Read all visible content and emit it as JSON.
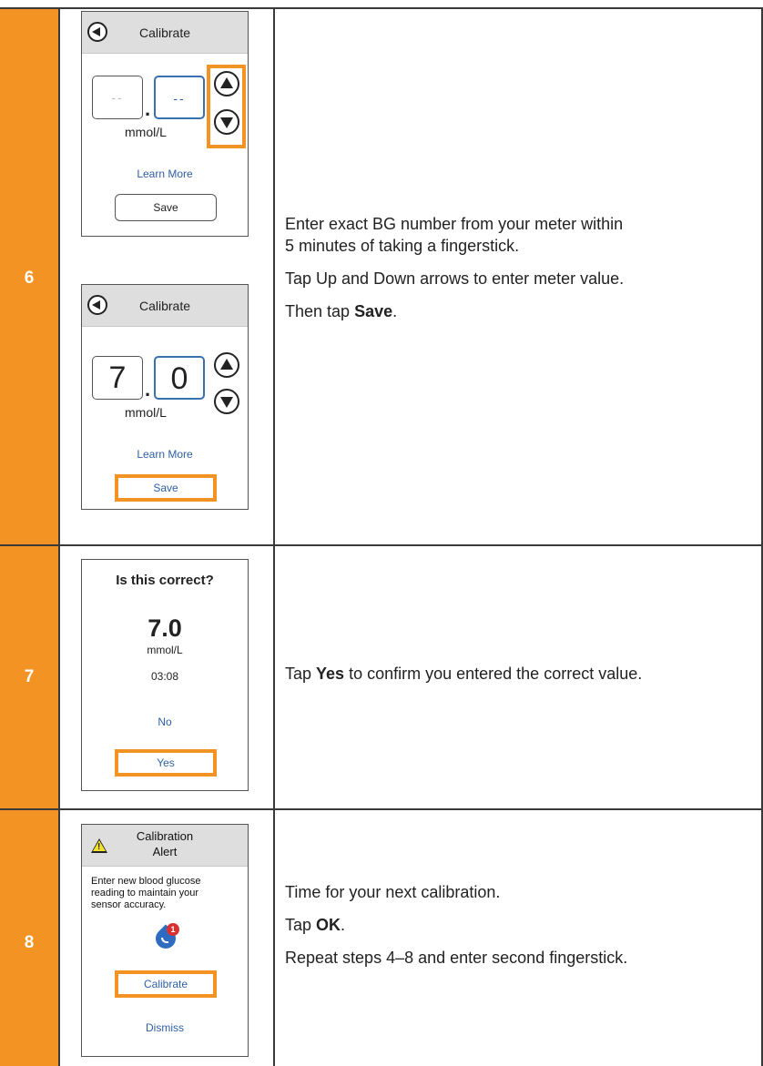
{
  "steps": [
    {
      "number": "6",
      "screens": [
        {
          "header_title": "Calibrate",
          "left_box": "--",
          "right_box": "--",
          "decimal": ".",
          "unit": "mmol/L",
          "learn_more": "Learn More",
          "save": "Save"
        },
        {
          "header_title": "Calibrate",
          "left_box": "7",
          "right_box": "0",
          "decimal": ".",
          "unit": "mmol/L",
          "learn_more": "Learn More",
          "save": "Save"
        }
      ],
      "description": {
        "line1": "Enter exact BG number from your meter within",
        "line2": "5 minutes of taking a fingerstick.",
        "line3": "Tap Up and Down arrows to enter meter value.",
        "line4_prefix": "Then tap ",
        "line4_bold": "Save",
        "line4_suffix": "."
      }
    },
    {
      "number": "7",
      "screen": {
        "question": "Is this correct?",
        "value": "7.0",
        "unit": "mmol/L",
        "time": "03:08",
        "no": "No",
        "yes": "Yes"
      },
      "description": {
        "prefix": "Tap ",
        "bold": "Yes",
        "suffix": " to confirm you entered the correct value."
      }
    },
    {
      "number": "8",
      "screen": {
        "header_line1": "Calibration",
        "header_line2": "Alert",
        "message_line1": "Enter new blood glucose",
        "message_line2": "reading to maintain your",
        "message_line3": "sensor accuracy.",
        "badge": "1",
        "calibrate": "Calibrate",
        "dismiss": "Dismiss"
      },
      "description": {
        "line1": "Time for your next calibration.",
        "line2_prefix": "Tap ",
        "line2_bold": "OK",
        "line2_suffix": ".",
        "line3": "Repeat steps 4–8 and enter second fingerstick."
      }
    }
  ],
  "colors": {
    "orange": "#f39323",
    "link_blue": "#2e5fa4",
    "header_gray": "#dedede",
    "drop_blue": "#2d6cc0",
    "badge_red": "#d93030",
    "warning_yellow": "#f6e32f"
  },
  "icons": [
    "back-arrow-icon",
    "up-arrow-icon",
    "down-arrow-icon",
    "warning-icon",
    "blood-drop-icon"
  ]
}
